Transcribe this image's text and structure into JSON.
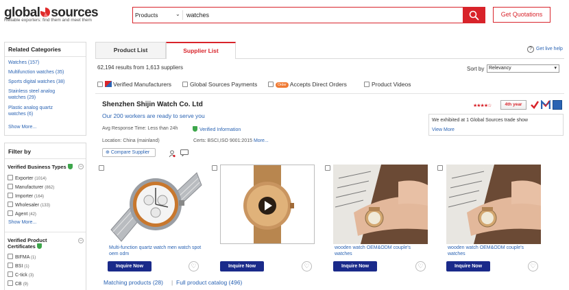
{
  "header": {
    "logo_text": "global sources",
    "tagline": "Reliable exporters: find them and meet them",
    "search_category": "Products",
    "search_value": "watches",
    "quote_button": "Get Quotations"
  },
  "related": {
    "title": "Related Categories",
    "items": [
      "Watches (157)",
      "Multifunction watches (35)",
      "Sports digital watches (38)",
      "Stainless steel analog watches (29)",
      "Plastic analog quartz watches (6)"
    ],
    "show_more": "Show More..."
  },
  "filter": {
    "title": "Filter by",
    "business_types": {
      "title": "Verified Business Types",
      "items": [
        {
          "label": "Exporter",
          "count": "(1014)"
        },
        {
          "label": "Manufacturer",
          "count": "(862)"
        },
        {
          "label": "Importer",
          "count": "(164)"
        },
        {
          "label": "Wholesaler",
          "count": "(133)"
        },
        {
          "label": "Agent",
          "count": "(42)"
        }
      ],
      "show_more": "Show More..."
    },
    "certificates": {
      "title": "Verified Product Certificates",
      "items": [
        {
          "label": "BIFMA",
          "count": "(1)"
        },
        {
          "label": "BSI",
          "count": "(1)"
        },
        {
          "label": "C-tick",
          "count": "(3)"
        },
        {
          "label": "CB",
          "count": "(9)"
        }
      ]
    }
  },
  "tabs": {
    "product_list": "Product List",
    "supplier_list": "Supplier List"
  },
  "help": "Get live help",
  "results": "62,194 results from 1,613 suppliers",
  "sort": {
    "label": "Sort by",
    "value": "Relevancy"
  },
  "filter_checks": {
    "verified_manufacturers": "Verified Manufacturers",
    "gs_payments": "Global Sources Payments",
    "order_badge": "Order",
    "direct_orders": "Accepts Direct Orders",
    "product_videos": "Product Videos"
  },
  "supplier": {
    "name": "Shenzhen Shijin Watch Co. Ltd",
    "slogan": "Our 200 workers are ready to serve you",
    "response_time": "Avg Response Time: Less than 24h",
    "verified_info": "Verified Information",
    "location": "Location: China (mainland)",
    "certs": "Certs: BSCI,ISO 9001:2015",
    "certs_more": "More...",
    "compare_button": "Compare Supplier",
    "stars": "★★★★☆",
    "year_badge": "4th year",
    "tradeshow_text": "We exhibited at 1 Global Sources trade show",
    "tradeshow_more": "View More"
  },
  "products": [
    {
      "caption": "Multi-function quartz watch men watch spot oem odm",
      "inquire": "Inquire Now"
    },
    {
      "caption": "",
      "inquire": "Inquire Now"
    },
    {
      "caption": "wooden watch OEM&ODM couple's watches",
      "inquire": "Inquire Now"
    },
    {
      "caption": "wooden watch OEM&ODM couple's watches",
      "inquire": "Inquire Now"
    }
  ],
  "footer_links": {
    "matching": "Matching products (28)",
    "separator": "|",
    "full_catalog": "Full product catalog (496)"
  },
  "colors": {
    "brand": "#d8232a",
    "link": "#2a63b3",
    "inquire": "#1a2a8a"
  }
}
